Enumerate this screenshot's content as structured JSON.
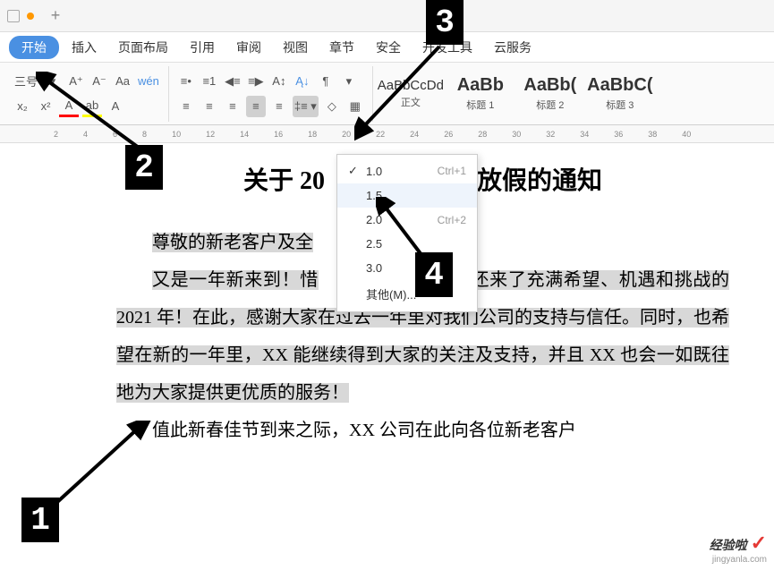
{
  "menu": {
    "tabs": [
      "开始",
      "插入",
      "页面布局",
      "引用",
      "审阅",
      "视图",
      "章节",
      "安全",
      "开发工具",
      "云服务"
    ],
    "active_index": 0
  },
  "toolbar": {
    "font_size_label": "三号",
    "line_spacing_values": [
      "1.0",
      "1.5",
      "2.0",
      "2.5",
      "3.0"
    ],
    "line_spacing_shortcuts": [
      "Ctrl+1",
      "",
      "Ctrl+2",
      "",
      ""
    ],
    "line_spacing_other": "其他(M)...",
    "current_spacing": "1.0"
  },
  "styles": [
    {
      "preview": "AaBbCcDd",
      "label": "正文",
      "big": false
    },
    {
      "preview": "AaBb",
      "label": "标题 1",
      "big": true
    },
    {
      "preview": "AaBb(",
      "label": "标题 2",
      "big": true
    },
    {
      "preview": "AaBbC(",
      "label": "标题 3",
      "big": true
    }
  ],
  "ruler": {
    "marks": [
      "2",
      "4",
      "6",
      "8",
      "10",
      "12",
      "14",
      "16",
      "18",
      "20",
      "22",
      "24",
      "26",
      "28",
      "30",
      "32",
      "34",
      "36",
      "38",
      "40"
    ]
  },
  "doc": {
    "title_before": "关于 20",
    "title_after": "放假的通知",
    "p1_line1": "尊敬的新老客户及全",
    "p1_line2": "又是一年新来到！惜",
    "p1_line3": "还来了充满希望、机遇和挑战的 2021 年！在此，感谢大家在过去一年里对我们公司的支持与信任。同时，也希望在新的一年里，XX 能继续得到大家的关注及支持，并且 XX 也会一如既往地为大家提供更优质的服务！",
    "p2": "值此新春佳节到来之际，XX 公司在此向各位新老客户"
  },
  "annotations": {
    "n1": "1",
    "n2": "2",
    "n3": "3",
    "n4": "4"
  },
  "watermark": {
    "big": "经验啦",
    "sub": "jingyanla.com"
  }
}
